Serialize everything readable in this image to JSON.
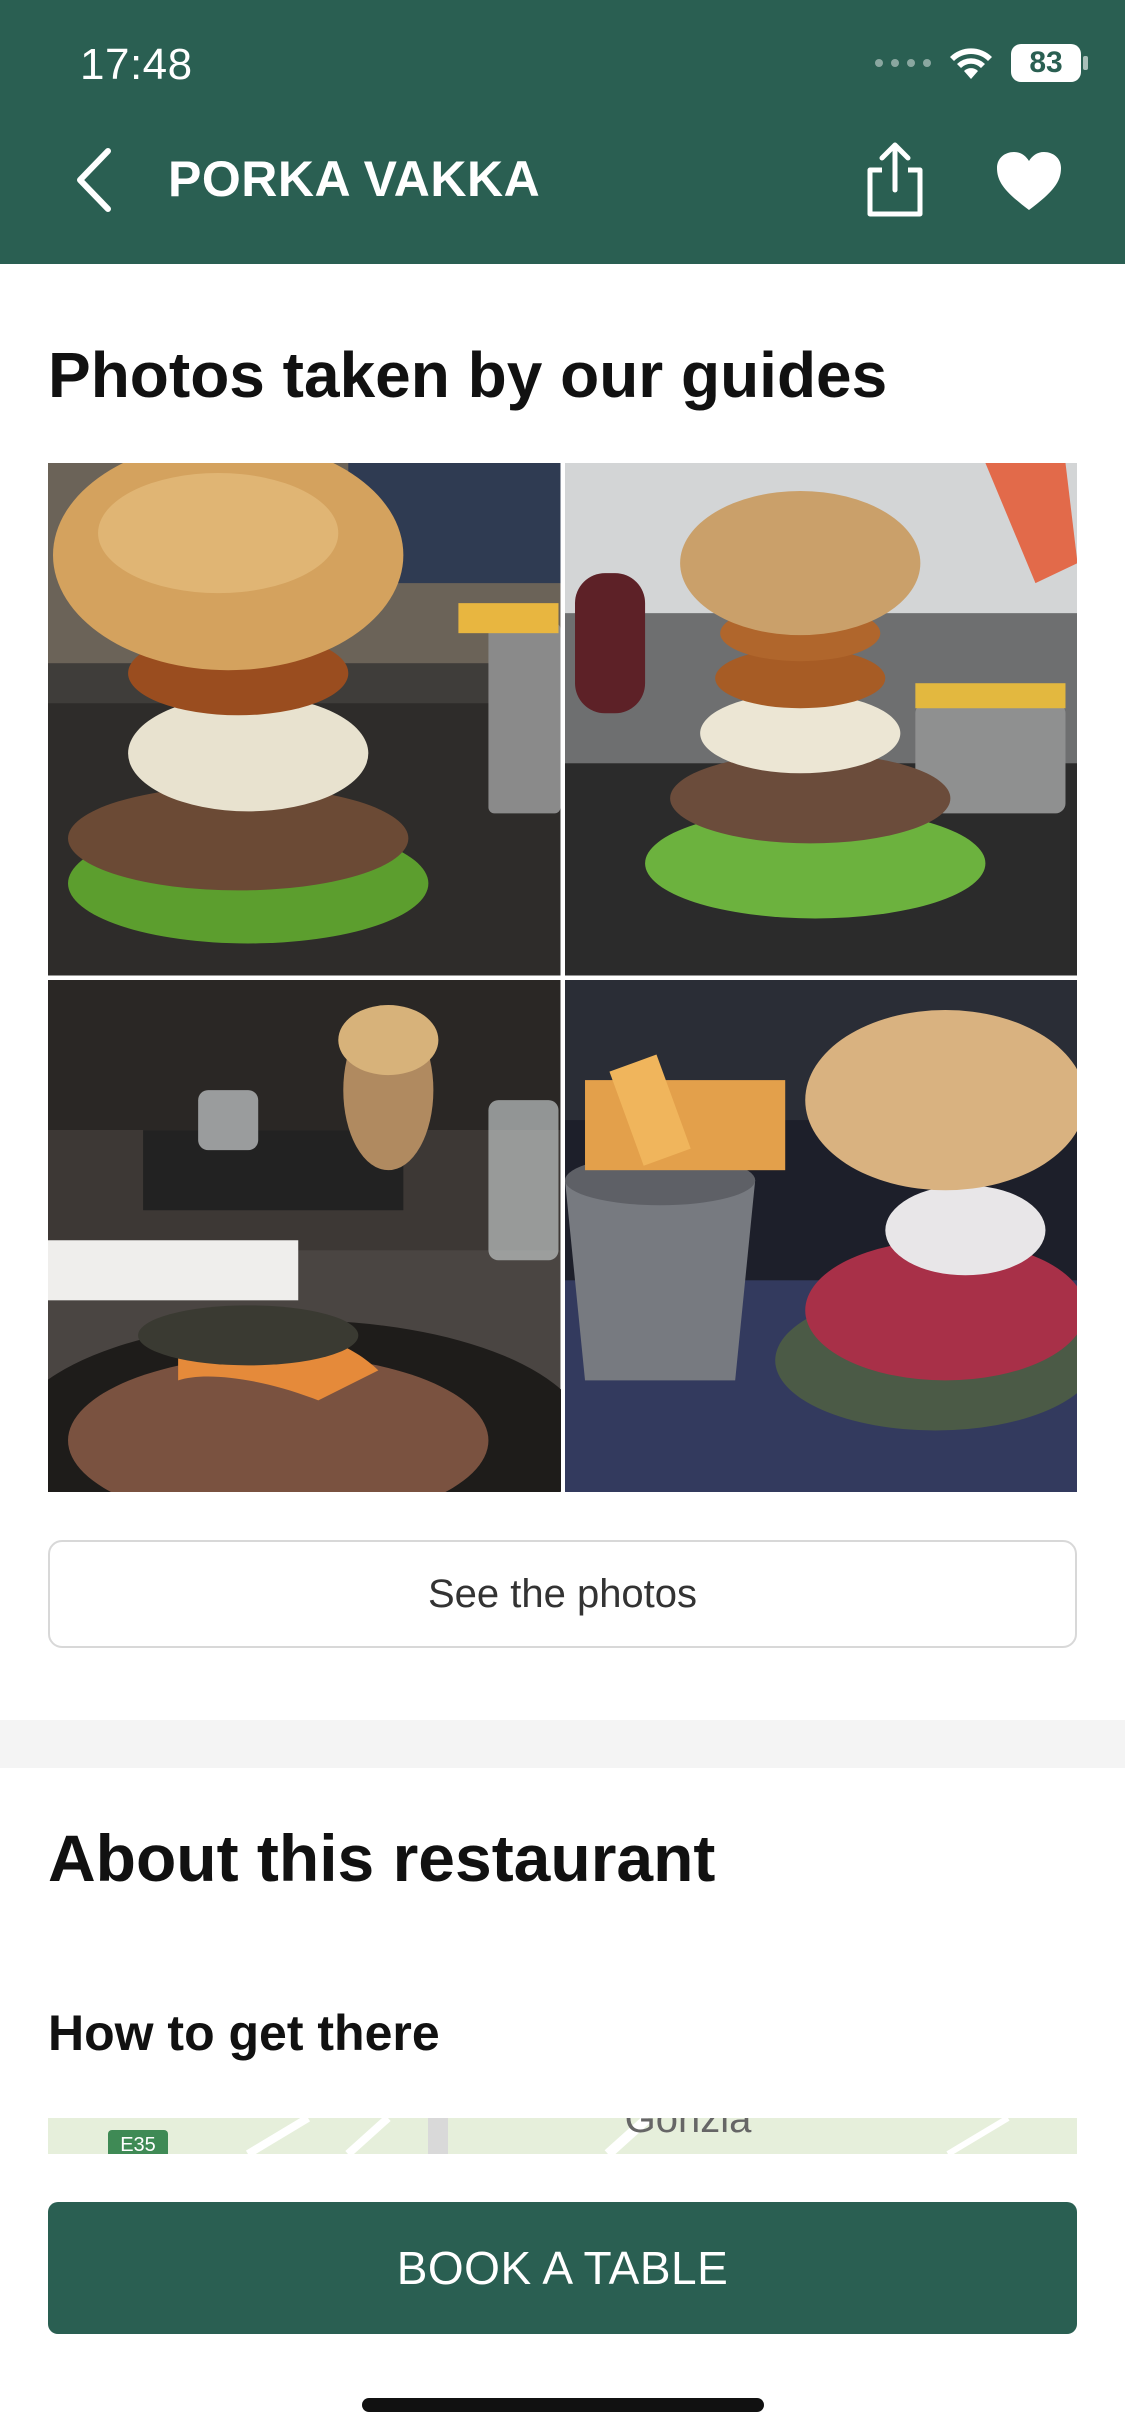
{
  "status_bar": {
    "time": "17:48",
    "battery": "83"
  },
  "nav": {
    "title": "PORKA VAKKA"
  },
  "photos": {
    "title": "Photos taken by our guides",
    "items": [
      "burger-photo",
      "burger-photo",
      "steak-photo",
      "burger-fries-photo"
    ],
    "button": "See the photos"
  },
  "about": {
    "title": "About this restaurant",
    "how_to_get_there": "How to get there"
  },
  "map": {
    "label": "Gorizia",
    "road_badge": "E35"
  },
  "cta": {
    "book": "BOOK A TABLE"
  },
  "colors": {
    "brand": "#2a5f52",
    "divider": "#f4f4f4"
  }
}
